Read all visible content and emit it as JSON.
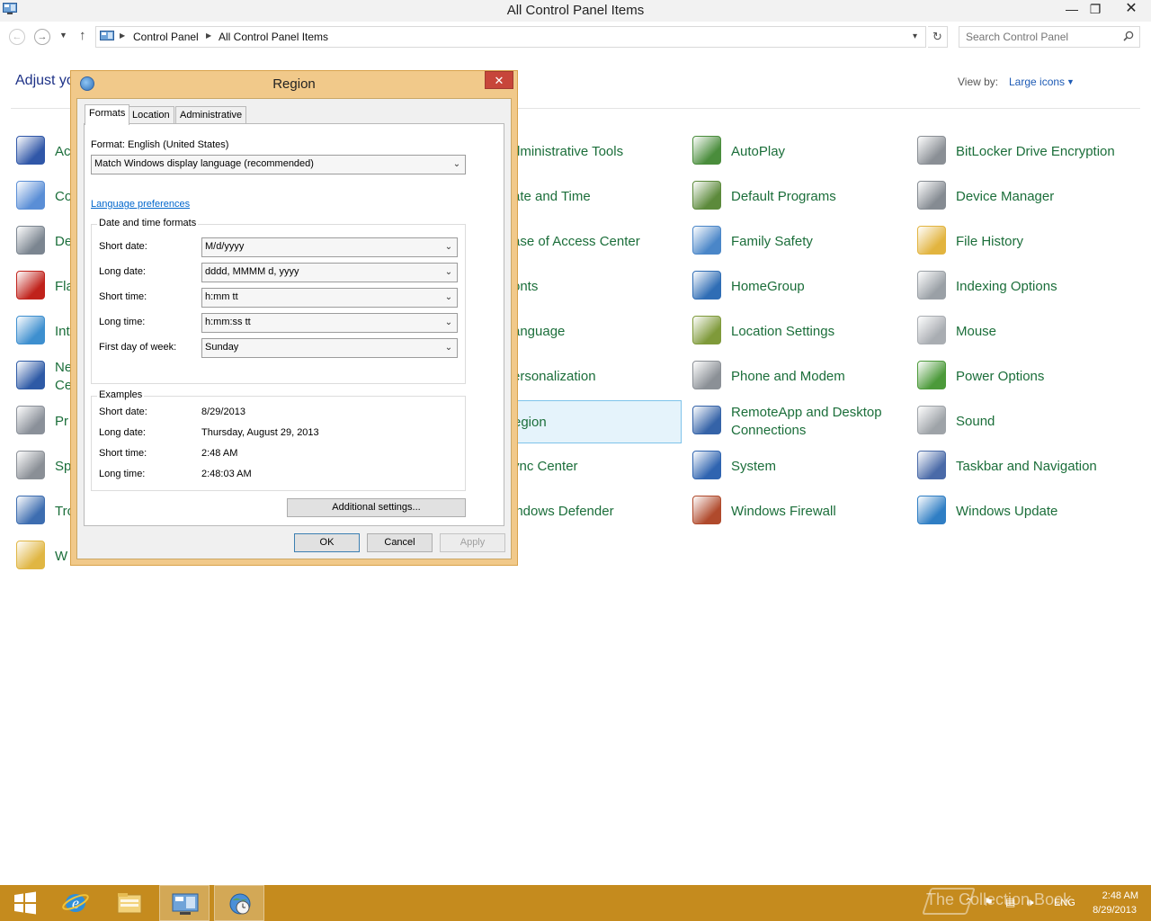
{
  "window": {
    "title": "All Control Panel Items",
    "min_glyph": "—",
    "max_glyph": "❐",
    "close_glyph": "✕"
  },
  "address_bar": {
    "crumbs": [
      "Control Panel",
      "All Control Panel Items"
    ],
    "search_placeholder": "Search Control Panel",
    "back_glyph": "←",
    "forward_glyph": "→",
    "recent_glyph": "▼",
    "up_glyph": "↑",
    "dropdown_glyph": "▾",
    "refresh_glyph": "↻"
  },
  "content": {
    "heading_visible": "Adjust yo",
    "view_by_label": "View by:",
    "view_by_value": "Large icons",
    "caret": "▼"
  },
  "items": {
    "col1": [
      {
        "label": "Ac",
        "icon": "action-center-flag-icon",
        "color": "#3057a8"
      },
      {
        "label": "Co",
        "icon": "color-management-icon",
        "color": "#5a8ed6"
      },
      {
        "label": "De",
        "icon": "devices-printers-icon",
        "color": "#7b8590"
      },
      {
        "label": "Fla",
        "icon": "flash-player-icon",
        "color": "#c0221b"
      },
      {
        "label": "Int",
        "icon": "internet-options-icon",
        "color": "#3d8fcf"
      },
      {
        "label": "Ne",
        "label2": "Ce",
        "icon": "network-sharing-icon",
        "color": "#2e5aa6"
      },
      {
        "label": "Pr",
        "icon": "programs-features-icon",
        "color": "#8a9099"
      },
      {
        "label": "Sp",
        "icon": "speech-recognition-mic-icon",
        "color": "#8a8f96"
      },
      {
        "label": "Tro",
        "icon": "troubleshooting-icon",
        "color": "#3d6db0"
      },
      {
        "label": "W",
        "icon": "work-folders-icon",
        "color": "#e0b643"
      }
    ],
    "col3": [
      {
        "label": "dministrative Tools",
        "icon": "administrative-tools-icon"
      },
      {
        "label": "ate and Time",
        "icon": "date-time-icon"
      },
      {
        "label": "ase of Access Center",
        "icon": "ease-of-access-icon"
      },
      {
        "label": "onts",
        "icon": "fonts-icon"
      },
      {
        "label": "anguage",
        "icon": "language-icon"
      },
      {
        "label": "ersonalization",
        "icon": "personalization-icon"
      },
      {
        "label": "egion",
        "icon": "region-icon"
      },
      {
        "label": "ync Center",
        "icon": "sync-center-icon"
      },
      {
        "label": "indows Defender",
        "icon": "windows-defender-icon"
      }
    ],
    "col4": [
      {
        "label": "AutoPlay",
        "icon": "autoplay-icon",
        "color": "#4a8d3c"
      },
      {
        "label": "Default Programs",
        "icon": "default-programs-icon",
        "color": "#5c8a3b"
      },
      {
        "label": "Family Safety",
        "icon": "family-safety-icon",
        "color": "#4a86c8"
      },
      {
        "label": "HomeGroup",
        "icon": "homegroup-icon",
        "color": "#2f6db5"
      },
      {
        "label": "Location Settings",
        "icon": "location-settings-icon",
        "color": "#7f9a3a"
      },
      {
        "label": "Phone and Modem",
        "icon": "phone-modem-icon",
        "color": "#8b9096"
      },
      {
        "label": "RemoteApp and Desktop",
        "label2": "Connections",
        "icon": "remoteapp-icon",
        "color": "#3563a8"
      },
      {
        "label": "System",
        "icon": "system-icon",
        "color": "#2f64b0"
      },
      {
        "label": "Windows Firewall",
        "icon": "windows-firewall-icon",
        "color": "#b04a2c"
      }
    ],
    "col5": [
      {
        "label": "BitLocker Drive Encryption",
        "icon": "bitlocker-icon",
        "color": "#8a8f95"
      },
      {
        "label": "Device Manager",
        "icon": "device-manager-icon",
        "color": "#858b92"
      },
      {
        "label": "File History",
        "icon": "file-history-icon",
        "color": "#e2b43f"
      },
      {
        "label": "Indexing Options",
        "icon": "indexing-options-icon",
        "color": "#9aa0a6"
      },
      {
        "label": "Mouse",
        "icon": "mouse-icon",
        "color": "#a9adb2"
      },
      {
        "label": "Power Options",
        "icon": "power-options-icon",
        "color": "#4c9a3a"
      },
      {
        "label": "Sound",
        "icon": "sound-icon",
        "color": "#9ea3a8"
      },
      {
        "label": "Taskbar and Navigation",
        "icon": "taskbar-navigation-icon",
        "color": "#4a6aa8"
      },
      {
        "label": "Windows Update",
        "icon": "windows-update-icon",
        "color": "#2f7ec4"
      }
    ]
  },
  "dialog": {
    "title": "Region",
    "close_glyph": "✕",
    "tabs": [
      "Formats",
      "Location",
      "Administrative"
    ],
    "format_label": "Format: English (United States)",
    "format_value": "Match Windows display language (recommended)",
    "language_link": "Language preferences",
    "dt_group_title": "Date and time formats",
    "dt_rows": [
      {
        "label": "Short date:",
        "value": "M/d/yyyy"
      },
      {
        "label": "Long date:",
        "value": "dddd, MMMM d, yyyy"
      },
      {
        "label": "Short time:",
        "value": "h:mm tt"
      },
      {
        "label": "Long time:",
        "value": "h:mm:ss tt"
      },
      {
        "label": "First day of week:",
        "value": "Sunday"
      }
    ],
    "examples_title": "Examples",
    "examples": [
      {
        "label": "Short date:",
        "value": "8/29/2013"
      },
      {
        "label": "Long date:",
        "value": "Thursday, August 29, 2013"
      },
      {
        "label": "Short time:",
        "value": "2:48 AM"
      },
      {
        "label": "Long time:",
        "value": "2:48:03 AM"
      }
    ],
    "additional_settings": "Additional settings...",
    "ok": "OK",
    "cancel": "Cancel",
    "apply": "Apply",
    "combo_arrow": "⌄"
  },
  "taskbar": {
    "apps": [
      "start-icon",
      "internet-explorer-icon",
      "file-explorer-icon",
      "control-panel-icon",
      "region-clock-icon"
    ],
    "tray_lang": "ENG",
    "time": "2:48 AM",
    "date": "8/29/2013",
    "watermark": "The Collection Book"
  }
}
